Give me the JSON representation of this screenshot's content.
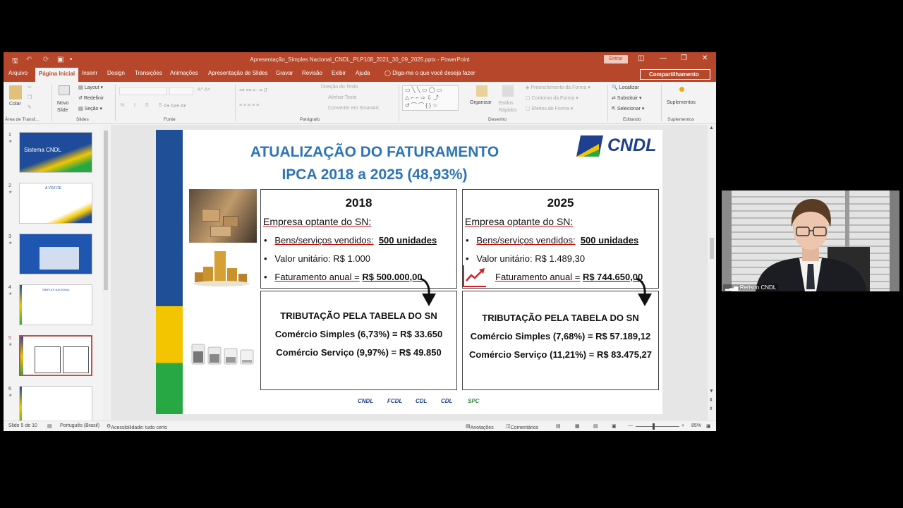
{
  "window": {
    "title": "Apresentação_Simples Nacional_CNDL_PLP108_2021_30_09_2025.pptx - PowerPoint",
    "signin": "Entrar",
    "share": "Compartilhamento",
    "tell_me": "Diga-me o que você deseja fazer"
  },
  "tabs": [
    "Arquivo",
    "Página Inicial",
    "Inserir",
    "Design",
    "Transições",
    "Animações",
    "Apresentação de Slides",
    "Gravar",
    "Revisão",
    "Exibir",
    "Ajuda"
  ],
  "ribbon": {
    "paste": "Colar",
    "clipboard": "Área de Transf...",
    "new_slide": "Novo Slide",
    "layout": "Layout",
    "reset": "Redefinir",
    "section": "Seção",
    "slides": "Slides",
    "font": "Fonte",
    "text_direction": "Direção do Texto",
    "align_text": "Alinhar Texto",
    "smartart": "Converter em SmartArt",
    "paragraph": "Parágrafo",
    "arrange": "Organizar",
    "quick_styles": "Estilos Rápidos",
    "shape_fill": "Preenchimento da Forma",
    "shape_outline": "Contorno da Forma",
    "shape_effects": "Efeitos de Forma",
    "drawing": "Desenho",
    "find": "Localizar",
    "replace": "Substituir",
    "select": "Selecionar",
    "editing": "Editando",
    "addins": "Suplementos",
    "addins_group": "Suplementos"
  },
  "thumbnails": {
    "numbers": [
      "1",
      "2",
      "3",
      "4",
      "5",
      "6"
    ],
    "t1_text": "Sistema CNDL",
    "t2_text": "A VOZ DE",
    "t4_text": "SIMPLES NACIONAL"
  },
  "slide": {
    "title": "ATUALIZAÇÃO DO FATURAMENTO\nIPCA 2018 a 2025 (48,93%)",
    "logo": "CNDL",
    "left": {
      "year": "2018",
      "classification": "Empresa optante do SN:",
      "b1_label": "Bens/serviços vendidos:",
      "b1_value": "500 unidades",
      "b2": "Valor unitário: R$ 1.000",
      "b3_label": "Faturamento anual =",
      "b3_value": "R$ 500.000,00",
      "trib_title": "TRIBUTAÇÃO PELA TABELA DO SN",
      "trib_1": "Comércio Simples (6,73%) = R$ 33.650",
      "trib_2": "Comércio Serviço (9,97%) = R$ 49.850"
    },
    "right": {
      "year": "2025",
      "classification": "Empresa optante do SN:",
      "b1_label": "Bens/serviços vendidos:",
      "b1_value": "500 unidades",
      "b2": "Valor unitário: R$ 1.489,30",
      "b3_label": "Faturamento anual =",
      "b3_value": "R$ 744.650,00",
      "trib_title": "TRIBUTAÇÃO PELA  TABELA DO SN",
      "trib_1": "Comércio Simples (7,68%) = R$ 57.189,12",
      "trib_2": "Comércio Serviço (11,21%) = R$ 83.475,27"
    },
    "footer_logos": [
      "CNDL",
      "FCDL",
      "CDL",
      "CDL",
      "SPC"
    ]
  },
  "status": {
    "slide": "Slide 5 de 10",
    "language": "Português (Brasil)",
    "accessibility": "Acessibilidade: tudo certo",
    "notes": "Anotações",
    "comments": "Comentários",
    "zoom": "85%"
  },
  "video": {
    "participant": "Rerison CNDL"
  },
  "colors": {
    "ppt_accent": "#b7472a",
    "title_blue": "#2e74b5",
    "cndl_blue": "#1f3f8f",
    "green": "#27a844",
    "yellow": "#f2c500"
  }
}
